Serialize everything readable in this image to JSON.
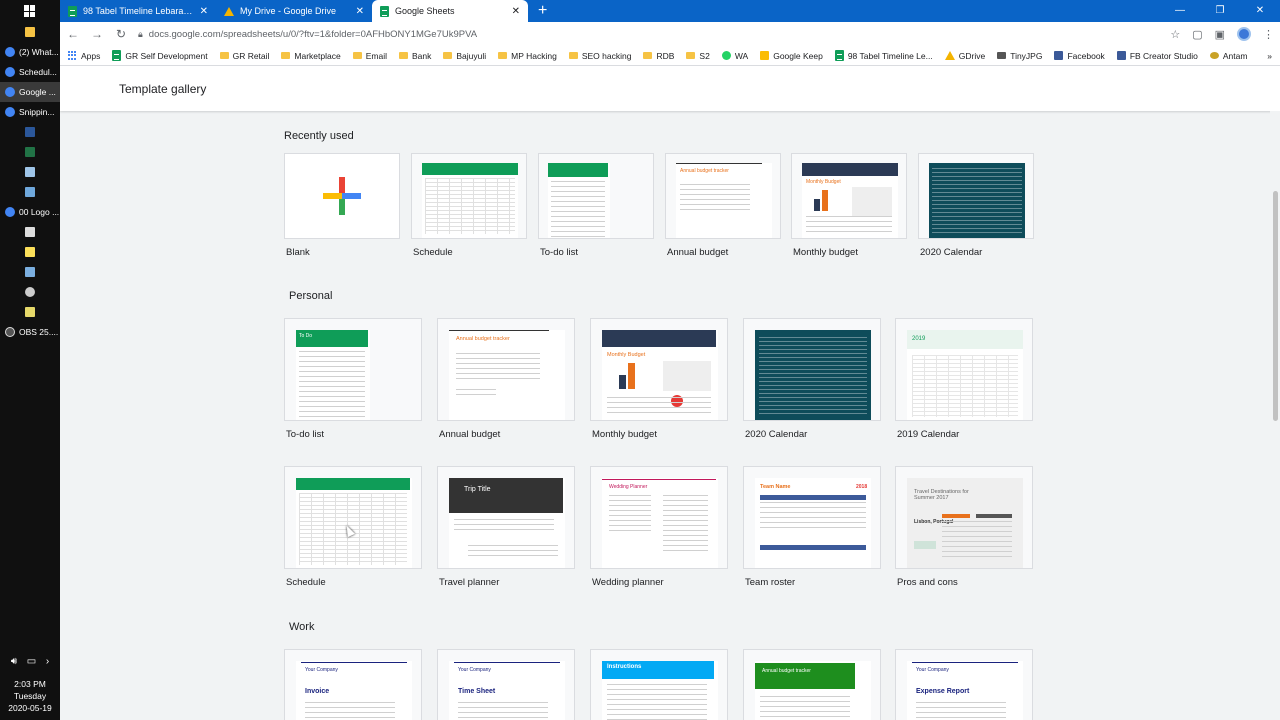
{
  "taskbar": {
    "apps": [
      {
        "label": "(2) What...",
        "icon": "chrome-icon"
      },
      {
        "label": "Schedul...",
        "icon": "chrome-icon"
      },
      {
        "label": "Google ...",
        "icon": "chrome-icon"
      },
      {
        "label": "Snippin...",
        "icon": "chrome-icon"
      },
      {
        "label": "00 Logo ...",
        "icon": "chrome-icon"
      },
      {
        "label": "OBS 25....",
        "icon": "obs-icon"
      }
    ],
    "clock": {
      "time": "2:03 PM",
      "day": "Tuesday",
      "date": "2020-05-19"
    }
  },
  "browser": {
    "tabs": [
      {
        "title": "98 Tabel Timeline Lebaran 2020 -",
        "icon": "sheets-icon",
        "active": false
      },
      {
        "title": "My Drive - Google Drive",
        "icon": "drive-icon",
        "active": false
      },
      {
        "title": "Google Sheets",
        "icon": "sheets-icon",
        "active": true
      }
    ],
    "new_tab": "+",
    "url": "docs.google.com/spreadsheets/u/0/?ftv=1&folder=0AFHbONY1MGe7Uk9PVA",
    "bookmarks": [
      {
        "label": "Apps",
        "icon": "apps-icon"
      },
      {
        "label": "GR Self Development",
        "icon": "sheets-icon"
      },
      {
        "label": "GR Retail",
        "icon": "folder-icon"
      },
      {
        "label": "Marketplace",
        "icon": "folder-icon"
      },
      {
        "label": "Email",
        "icon": "folder-icon"
      },
      {
        "label": "Bank",
        "icon": "folder-icon"
      },
      {
        "label": "Bajuyuli",
        "icon": "folder-icon"
      },
      {
        "label": "MP Hacking",
        "icon": "folder-icon"
      },
      {
        "label": "SEO hacking",
        "icon": "folder-icon"
      },
      {
        "label": "RDB",
        "icon": "folder-icon"
      },
      {
        "label": "S2",
        "icon": "folder-icon"
      },
      {
        "label": "WA",
        "icon": "whatsapp-icon"
      },
      {
        "label": "Google Keep",
        "icon": "keep-icon"
      },
      {
        "label": "98 Tabel Timeline Le...",
        "icon": "sheets-icon"
      },
      {
        "label": "GDrive",
        "icon": "drive-icon"
      },
      {
        "label": "TinyJPG",
        "icon": "panda-icon"
      },
      {
        "label": "Facebook",
        "icon": "facebook-icon"
      },
      {
        "label": "FB Creator Studio",
        "icon": "facebook-icon"
      },
      {
        "label": "Antam",
        "icon": "antam-icon"
      }
    ]
  },
  "gallery": {
    "title": "Template gallery",
    "sections": [
      {
        "title": "Recently used",
        "templates": [
          "Blank",
          "Schedule",
          "To-do list",
          "Annual budget",
          "Monthly budget",
          "2020 Calendar"
        ]
      },
      {
        "title": "Personal",
        "templates": [
          "To-do list",
          "Annual budget",
          "Monthly budget",
          "2020 Calendar",
          "2019 Calendar",
          "Schedule",
          "Travel planner",
          "Wedding planner",
          "Team roster",
          "Pros and cons"
        ]
      },
      {
        "title": "Work",
        "templates": [
          "Invoice",
          "Time Sheet",
          "Instructions",
          "Annual budget tracker",
          "Expense Report"
        ]
      }
    ],
    "thumb_text": {
      "trip_title": "Trip Title",
      "wedding": "Wedding Planner",
      "team": "Team Name",
      "team_year": "2018",
      "travel": "Travel Destinations for Summer 2017",
      "lisbon": "Lisbon, Portugal",
      "monthly": "Monthly Budget",
      "annual": "Annual budget tracker",
      "todo": "To Do",
      "year2019": "2019",
      "your_company": "Your Company",
      "invoice": "Invoice",
      "time_sheet": "Time Sheet",
      "instructions": "Instructions",
      "expense": "Expense Report"
    }
  }
}
